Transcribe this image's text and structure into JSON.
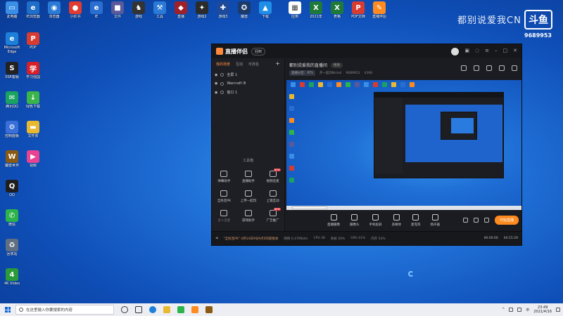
{
  "desktop_icons": [
    {
      "label": "此电脑",
      "color": "#3a8ee6",
      "glyph": "▭",
      "col": 0,
      "row": 0
    },
    {
      "label": "Microsoft Edge",
      "color": "#1e7fd8",
      "glyph": "e",
      "col": 0,
      "row": 1
    },
    {
      "label": "SSR客服",
      "color": "#222222",
      "glyph": "S",
      "col": 0,
      "row": 2
    },
    {
      "label": "腾讯QQ",
      "color": "#1aa260",
      "glyph": "✉",
      "col": 0,
      "row": 3
    },
    {
      "label": "控制面板",
      "color": "#3a6fd8",
      "glyph": "⚙",
      "col": 0,
      "row": 4
    },
    {
      "label": "魔兽世界",
      "color": "#8a5a12",
      "glyph": "W",
      "col": 0,
      "row": 5
    },
    {
      "label": "QQ",
      "color": "#1e1e1e",
      "glyph": "Q",
      "col": 0,
      "row": 6
    },
    {
      "label": "微信",
      "color": "#2cb44a",
      "glyph": "✆",
      "col": 0,
      "row": 7
    },
    {
      "label": "回收站",
      "color": "#607080",
      "glyph": "♻",
      "col": 0,
      "row": 8
    },
    {
      "label": "4K Video",
      "color": "#2b9a3a",
      "glyph": "4",
      "col": 0,
      "row": 9
    },
    {
      "label": "IE浏览器",
      "color": "#1f6fc8",
      "glyph": "e",
      "col": 1,
      "row": 0
    },
    {
      "label": "PDF",
      "color": "#d83b2f",
      "glyph": "P",
      "col": 1,
      "row": 1
    },
    {
      "label": "学习强国",
      "color": "#d61f26",
      "glyph": "学",
      "col": 1,
      "row": 2
    },
    {
      "label": "绿色下载",
      "color": "#3bb54a",
      "glyph": "↓",
      "col": 1,
      "row": 3
    },
    {
      "label": "文件夹",
      "color": "#e8b930",
      "glyph": "▬",
      "col": 1,
      "row": 4
    },
    {
      "label": "视频",
      "color": "#e84393",
      "glyph": "▶",
      "col": 1,
      "row": 5
    },
    {
      "label": "浏览器",
      "color": "#2a7ad6",
      "glyph": "◉",
      "col": 2,
      "row": 0
    },
    {
      "label": "小红书",
      "color": "#e03c31",
      "glyph": "●",
      "col": 3,
      "row": 0
    },
    {
      "label": "IE",
      "color": "#2a6fd0",
      "glyph": "e",
      "col": 4,
      "row": 0
    },
    {
      "label": "文件",
      "color": "#5a5a9a",
      "glyph": "■",
      "col": 5,
      "row": 0
    },
    {
      "label": "游戏",
      "color": "#333333",
      "glyph": "♞",
      "col": 6,
      "row": 0
    },
    {
      "label": "工具",
      "color": "#2a7ad6",
      "glyph": "⚒",
      "col": 7,
      "row": 0
    },
    {
      "label": "直播",
      "color": "#a0202a",
      "glyph": "◆",
      "col": 8,
      "row": 0
    },
    {
      "label": "游戏2",
      "color": "#2b2b2b",
      "glyph": "✦",
      "col": 9,
      "row": 0
    },
    {
      "label": "游戏3",
      "color": "#1f4a9a",
      "glyph": "✚",
      "col": 10,
      "row": 0
    },
    {
      "label": "魔兽",
      "color": "#1c3a6a",
      "glyph": "✪",
      "col": 11,
      "row": 0
    },
    {
      "label": "下载",
      "color": "#1f8ee6",
      "glyph": "▲",
      "col": 12,
      "row": 0
    },
    {
      "label": "应用",
      "color": "#ffffff",
      "glyph": "▦",
      "col": 13,
      "row": 0
    },
    {
      "label": "2021年",
      "color": "#1f7a3a",
      "glyph": "X",
      "col": 14,
      "row": 0
    },
    {
      "label": "表格",
      "color": "#1f7a3a",
      "glyph": "X",
      "col": 15,
      "row": 0
    },
    {
      "label": "PDF文档",
      "color": "#d83b2f",
      "glyph": "P",
      "col": 16,
      "row": 0
    },
    {
      "label": "直播伴侣",
      "color": "#ff8a1f",
      "glyph": "✎",
      "col": 17,
      "row": 0
    }
  ],
  "watermark": {
    "text": "都别说爱我CN",
    "logo": "斗鱼",
    "id": "9689953"
  },
  "app": {
    "name": "直播伴侣",
    "badge": "回到",
    "side_tabs": [
      "我的场景",
      "互动",
      "可改名"
    ],
    "scenes": [
      "全屏 1",
      "Warcraft III",
      "窗口 1"
    ],
    "toolbox_title": "工具箱",
    "tools": [
      {
        "label": "弹幕助手",
        "dim": false,
        "hot": false
      },
      {
        "label": "直播助手",
        "dim": false,
        "hot": false
      },
      {
        "label": "视频连麦",
        "dim": false,
        "hot": true
      },
      {
        "label": "全民连PK",
        "dim": false,
        "hot": false
      },
      {
        "label": "上传一起玩",
        "dim": false,
        "hot": false
      },
      {
        "label": "上镜互动",
        "dim": false,
        "hot": false
      },
      {
        "label": "多人连麦",
        "dim": true,
        "hot": false
      },
      {
        "label": "游戏助手",
        "dim": false,
        "hot": false
      },
      {
        "label": "广告推广",
        "dim": false,
        "hot": true
      }
    ],
    "room_title": "都别说爱我的直播间",
    "room_tag": "修改",
    "room_meta": [
      "直播分区：RTS",
      "开一起的Nickel",
      "9689953",
      "4368"
    ],
    "controls": [
      "直播摄像",
      "摄像头",
      "手机投屏",
      "多媒体",
      "麦克风",
      "扬声器"
    ],
    "start_button": "开始直播",
    "status": {
      "notice": "\"全民连PK\" 4月14日9号9点5的新版本",
      "items": [
        "网络 0.47Mbit/s",
        "CPU 38",
        "系统 40%",
        "GPU 41%",
        "内存 54%"
      ],
      "time_a": "00:00:00",
      "time_b": "04:15:29"
    }
  },
  "taskbar": {
    "search_placeholder": "在这里输入你要搜索的内容",
    "time": "23:49",
    "date": "2021/4/16"
  }
}
